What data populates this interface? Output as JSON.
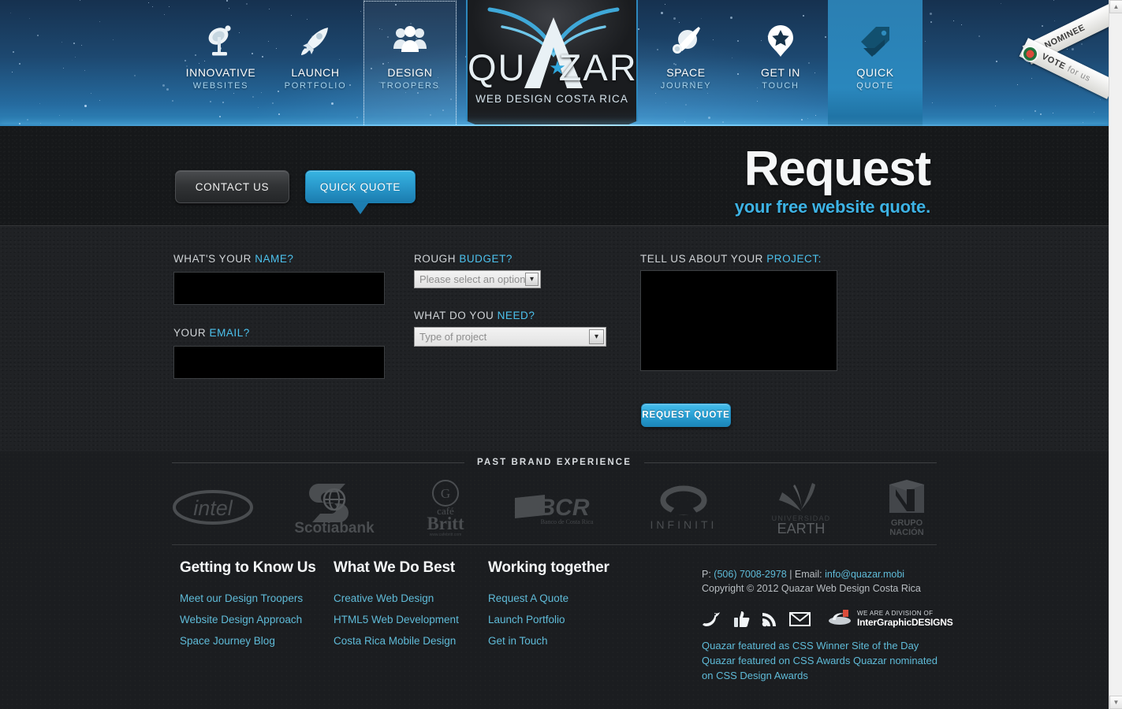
{
  "brand": {
    "logo_text": "QUAZAR",
    "logo_part1": "QU",
    "logo_part2": "ZAR",
    "logo_tagline": "WEB DESIGN COSTA RICA",
    "accent_color": "#2fa6dc",
    "link_color": "#5fbbd8"
  },
  "ribbon": {
    "line1": "NOMINEE",
    "line2": "VOTE",
    "line2_light": "for us"
  },
  "nav": {
    "items": [
      {
        "title": "INNOVATIVE",
        "subtitle": "WEBSITES",
        "icon": "satellite-dish-icon"
      },
      {
        "title": "LAUNCH",
        "subtitle": "PORTFOLIO",
        "icon": "rocket-icon"
      },
      {
        "title": "DESIGN",
        "subtitle": "TROOPERS",
        "icon": "people-group-icon"
      },
      {
        "title": "SPACE",
        "subtitle": "JOURNEY",
        "icon": "comet-planet-icon"
      },
      {
        "title": "GET IN",
        "subtitle": "TOUCH",
        "icon": "map-pin-star-icon"
      },
      {
        "title": "QUICK",
        "subtitle": "QUOTE",
        "icon": "price-tag-icon"
      }
    ]
  },
  "hero": {
    "contact_button": "CONTACT US",
    "quote_button": "QUICK QUOTE",
    "title": "Request",
    "subtitle": "your free website quote."
  },
  "form": {
    "name_label_plain": "WHAT'S YOUR ",
    "name_label_hi": "NAME?",
    "name_value": "",
    "email_label_plain": "YOUR ",
    "email_label_hi": "EMAIL?",
    "email_value": "",
    "budget_label_plain": "ROUGH ",
    "budget_label_hi": "BUDGET?",
    "budget_value": "Please select an option",
    "need_label_plain": "WHAT DO YOU ",
    "need_label_hi": "NEED?",
    "need_value": "Type of project",
    "project_label_plain": "TELL US ABOUT YOUR ",
    "project_label_hi": "PROJECT:",
    "project_value": "",
    "submit_button": "REQUEST QUOTE",
    "dropdown_arrow": "▾"
  },
  "brands": {
    "title": "PAST BRAND EXPERIENCE",
    "items": [
      {
        "name": "intel",
        "icon": "intel-logo"
      },
      {
        "name": "Scotiabank",
        "icon": "scotiabank-logo"
      },
      {
        "name": "café Britt",
        "icon": "cafe-britt-logo"
      },
      {
        "name": "BCR",
        "icon": "bcr-logo"
      },
      {
        "name": "INFINITI",
        "icon": "infiniti-logo"
      },
      {
        "name": "EARTH",
        "icon": "universidad-earth-logo"
      },
      {
        "name": "GRUPO NACIÓN",
        "icon": "grupo-nacion-logo"
      }
    ],
    "britt_top": "café",
    "britt_main": "Britt",
    "britt_url": "www.cafebritt.com",
    "bcr_sub": "Banco de Costa Rica",
    "earth_top": "UNIVERSIDAD",
    "earth_main": "EARTH",
    "nacion_top": "GRUPO",
    "nacion_main": "NACIÓN"
  },
  "footer": {
    "columns": [
      {
        "heading": "Getting to Know Us",
        "links": [
          "Meet our Design Troopers",
          "Website Design Approach",
          "Space Journey Blog"
        ]
      },
      {
        "heading": "What We Do Best",
        "links": [
          "Creative Web Design",
          "HTML5 Web Development",
          "Costa Rica Mobile Design"
        ]
      },
      {
        "heading": "Working together",
        "links": [
          "Request A Quote",
          "Launch Portfolio",
          "Get in Touch"
        ]
      }
    ],
    "phone_prefix": "P: ",
    "phone": "(506) 7008-2978",
    "separator": " | Email: ",
    "email": "info@quazar.mobi",
    "copyright": "Copyright © 2012 Quazar Web Design Costa Rica",
    "socials": [
      {
        "icon": "twitter-bird-icon",
        "label": "Twitter"
      },
      {
        "icon": "thumbs-up-icon",
        "label": "Facebook"
      },
      {
        "icon": "rss-icon",
        "label": "RSS"
      },
      {
        "icon": "envelope-icon",
        "label": "Email"
      }
    ],
    "division_top": "WE ARE A DIVISION OF",
    "division_name": "InterGraphicDESIGNS",
    "awards": "Quazar featured as CSS Winner Site of the Day Quazar featured on CSS Awards Quazar nominated on CSS Design Awards"
  },
  "scrollbar": {
    "up_arrow": "▲",
    "down_arrow": "▼"
  }
}
